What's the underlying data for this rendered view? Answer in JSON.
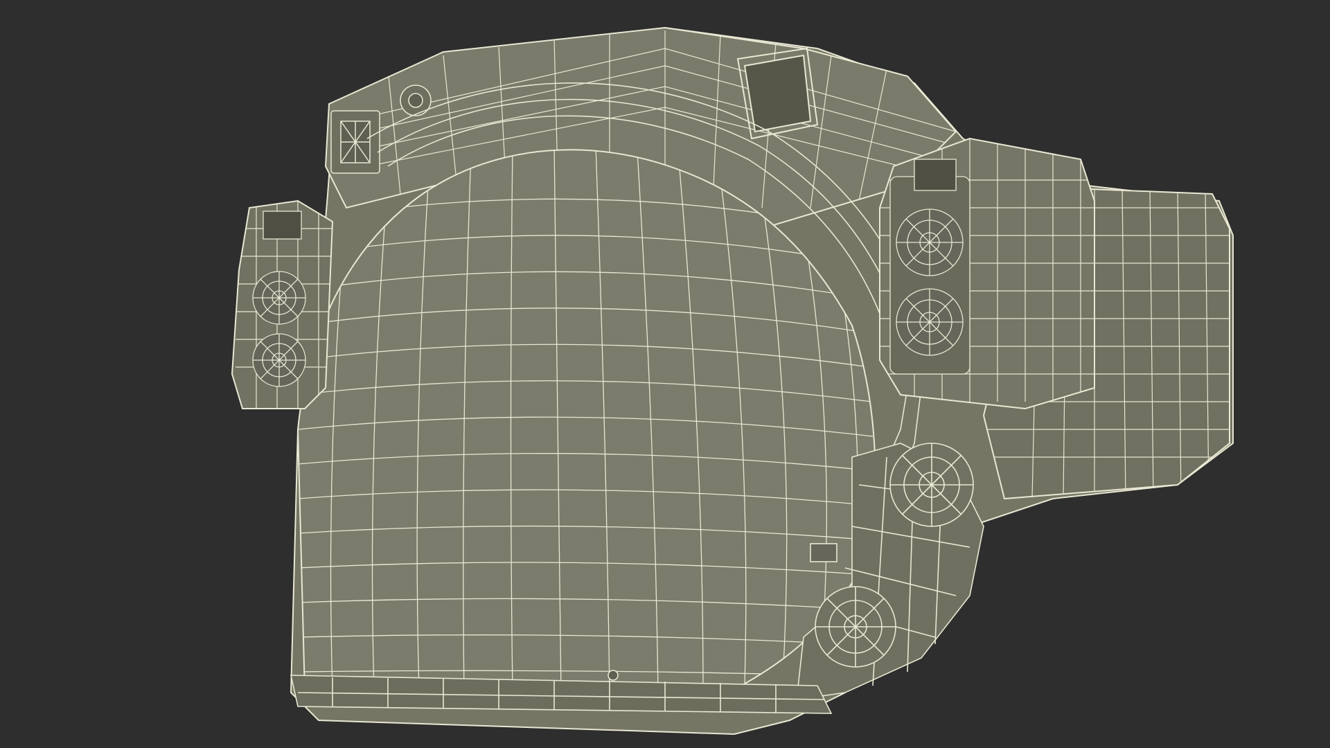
{
  "scene": {
    "background_color": "#2e2e2e",
    "shell_color": "#7a7a6a",
    "shell_shadow_color": "#5f5f52",
    "wire_color": "#e9e8d3"
  }
}
